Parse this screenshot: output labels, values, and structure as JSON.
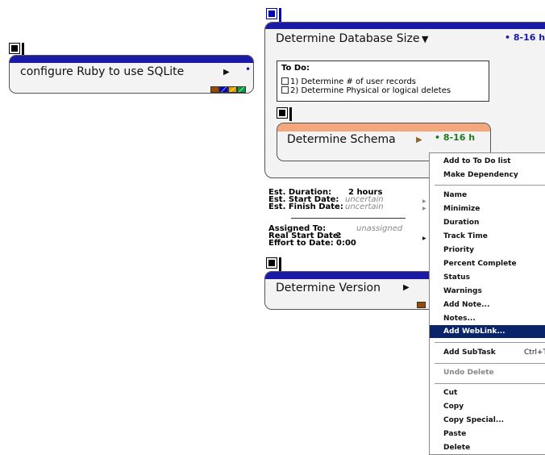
{
  "cards": {
    "ruby": {
      "title": "configure Ruby to use SQLite",
      "arrow": "▶",
      "dot": "•"
    },
    "database": {
      "title": "Determine Database Size",
      "arrow": "▼",
      "range": "• 8-16 h"
    },
    "schema": {
      "title": "Determine Schema",
      "arrow": "▶",
      "range": "• 8-16 h"
    },
    "version": {
      "title": "Determine Version",
      "arrow": "▶"
    }
  },
  "todo": {
    "heading": "To Do:",
    "items": [
      "1) Determine # of user records",
      "2) Determine Physical or logical deletes"
    ]
  },
  "info": {
    "est_duration_label": "Est. Duration:",
    "est_duration_value": "2 hours",
    "est_start_label": "Est. Start Date:",
    "est_start_value": "uncertain",
    "est_finish_label": "Est. Finish Date:",
    "est_finish_value": "uncertain",
    "assigned_label": "Assigned To:",
    "assigned_value": "unassigned",
    "real_start_label": "Real Start Date:",
    "real_start_value": "?",
    "effort_label": "Effort to Date:",
    "effort_value": "0:00"
  },
  "context_menu": {
    "items": [
      {
        "label": "Add to To Do list"
      },
      {
        "label": "Make Dependency"
      },
      {
        "label": "Name"
      },
      {
        "label": "Minimize"
      },
      {
        "label": "Duration"
      },
      {
        "label": "Track Time"
      },
      {
        "label": "Priority"
      },
      {
        "label": "Percent Complete"
      },
      {
        "label": "Status"
      },
      {
        "label": "Warnings"
      },
      {
        "label": "Add Note..."
      },
      {
        "label": "Notes..."
      },
      {
        "label": "Add WebLink...",
        "selected": true
      },
      {
        "label": "Add SubTask",
        "shortcut": "Ctrl+T"
      },
      {
        "label": "Undo Delete",
        "disabled": true
      },
      {
        "label": "Cut"
      },
      {
        "label": "Copy"
      },
      {
        "label": "Copy Special..."
      },
      {
        "label": "Paste"
      },
      {
        "label": "Delete"
      }
    ]
  },
  "colors": {
    "header_band": "#1a1aa6",
    "schema_band": "#f4a77a",
    "selection": "#0a246a",
    "range_blue": "#1a1aa6",
    "range_green": "#1e7a1e"
  }
}
